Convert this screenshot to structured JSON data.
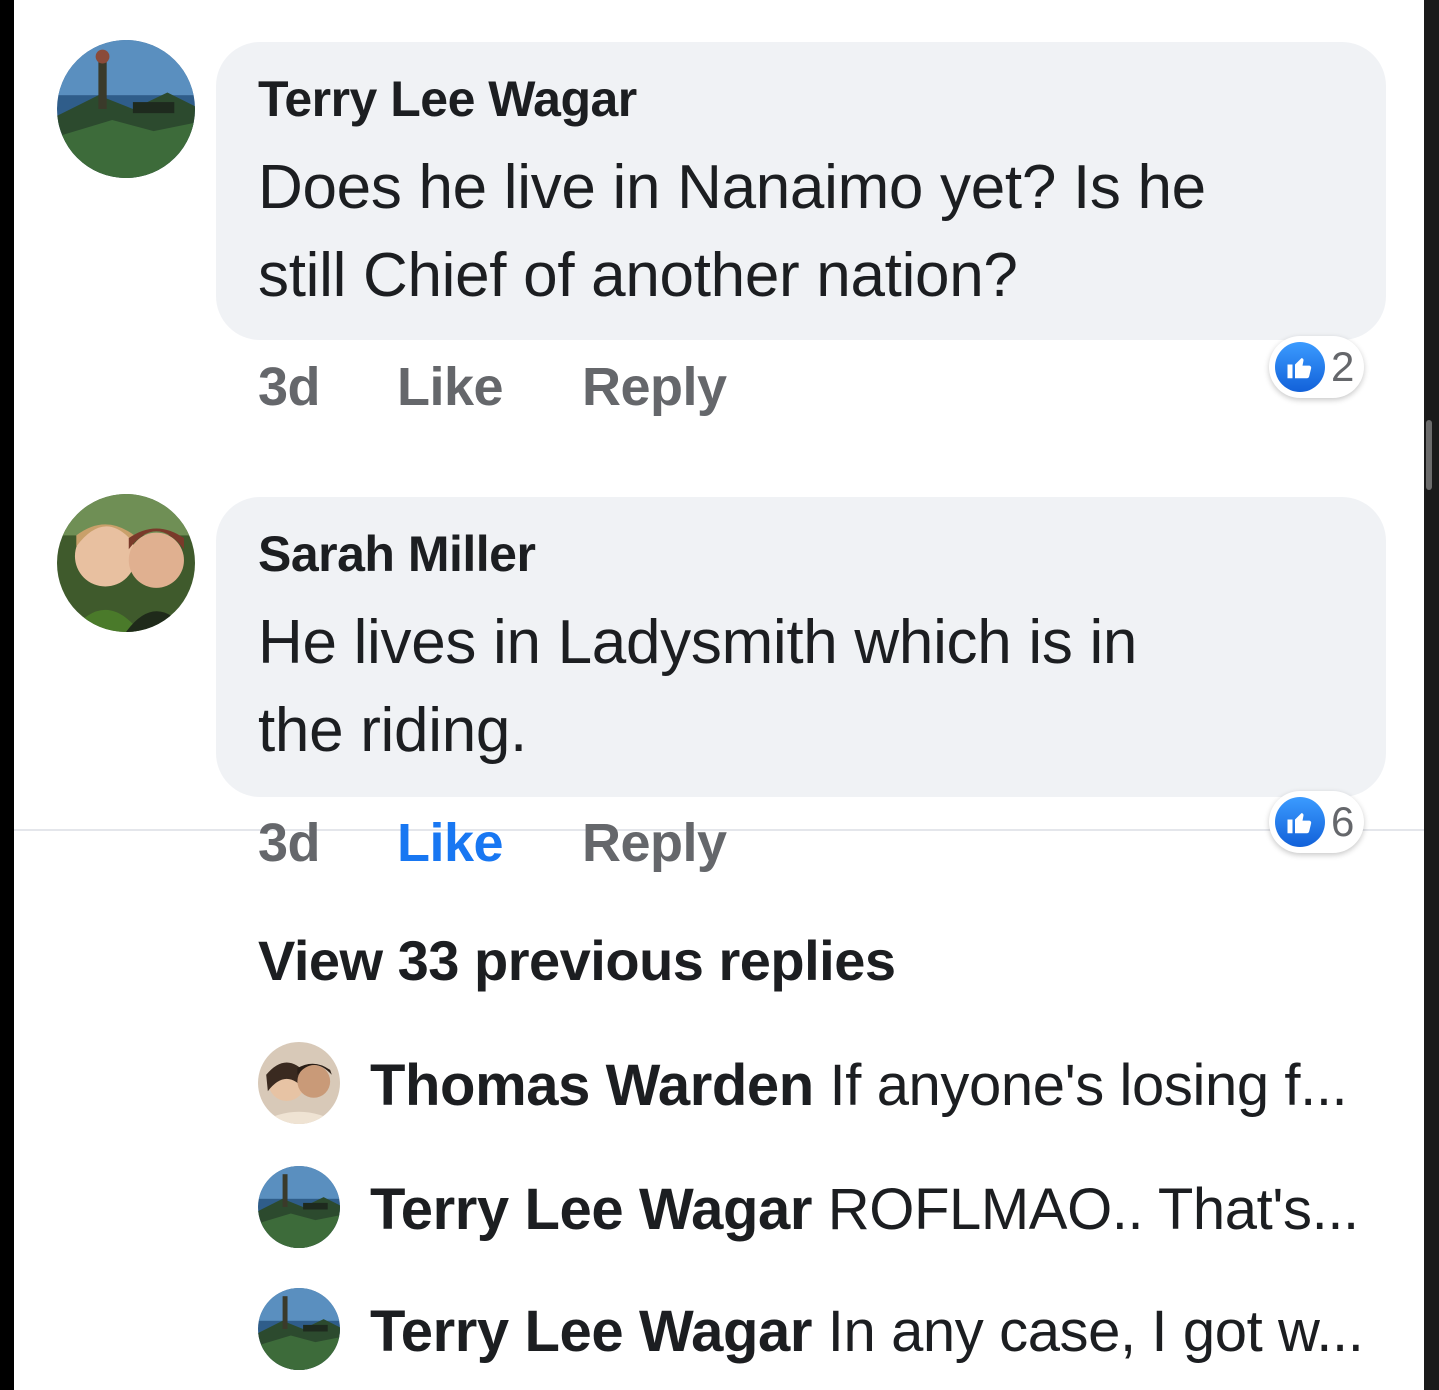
{
  "comments": [
    {
      "author": "Terry Lee Wagar",
      "lines": [
        "Does he live in Nanaimo yet? Is he",
        "still Chief of another nation?"
      ],
      "time": "3d",
      "like_label": "Like",
      "reply_label": "Reply",
      "liked": false,
      "reaction_count": "2"
    },
    {
      "author": "Sarah Miller",
      "lines": [
        "He lives in Ladysmith which is in",
        "the riding."
      ],
      "time": "3d",
      "like_label": "Like",
      "reply_label": "Reply",
      "liked": true,
      "reaction_count": "6"
    }
  ],
  "view_previous": "View 33 previous replies",
  "replies": [
    {
      "author": "Thomas Warden",
      "snippet": "If anyone's losing f..."
    },
    {
      "author": "Terry Lee Wagar",
      "snippet": "ROFLMAO.. That's..."
    },
    {
      "author": "Terry Lee Wagar",
      "snippet": "In any case, I got w..."
    }
  ],
  "colors": {
    "bubble": "#f0f2f5",
    "text": "#1c1e21",
    "meta": "#65676b",
    "accent": "#1877f2"
  },
  "icons": {
    "reaction": "thumbs-up-icon",
    "avatar": "profile-photo"
  }
}
